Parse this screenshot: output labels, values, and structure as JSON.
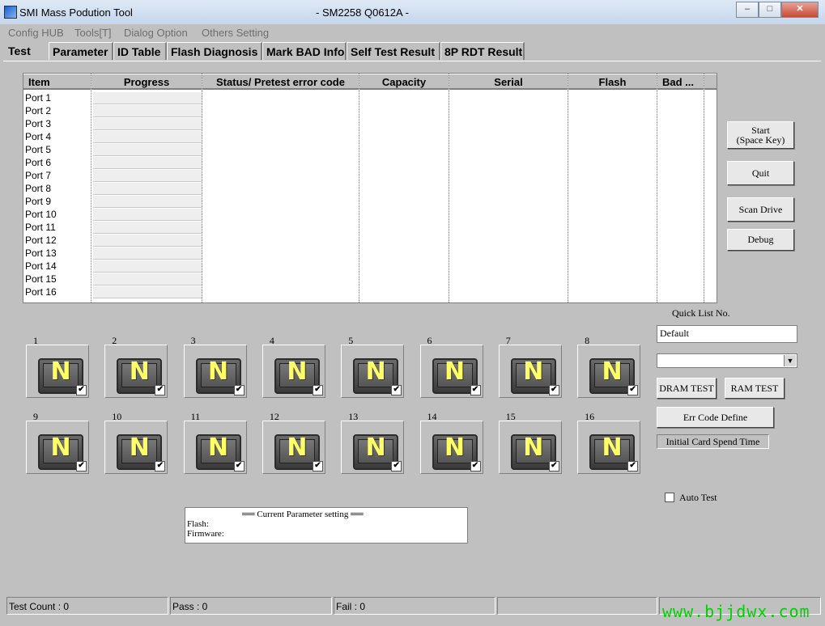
{
  "window": {
    "app_title": "SMI Mass Podution Tool",
    "center_title": "- SM2258 Q0612A -",
    "controls": {
      "minimize": "–",
      "maximize": "□",
      "close": "✕"
    }
  },
  "menu": [
    "Config HUB",
    "Tools[T]",
    "Dialog Option",
    "Others Setting"
  ],
  "tabs": [
    "Test",
    "Parameter",
    "ID Table",
    "Flash Diagnosis",
    "Mark BAD Info",
    "Self Test Result",
    "8P RDT Result"
  ],
  "active_tab": "Test",
  "table": {
    "columns": [
      "Item",
      "Progress",
      "Status/ Pretest error code",
      "Capacity",
      "Serial",
      "Flash",
      "Bad ..."
    ],
    "rows": [
      "Port 1",
      "Port 2",
      "Port 3",
      "Port 4",
      "Port 5",
      "Port 6",
      "Port 7",
      "Port 8",
      "Port 9",
      "Port 10",
      "Port 11",
      "Port 12",
      "Port 13",
      "Port 14",
      "Port 15",
      "Port 16"
    ]
  },
  "buttons": {
    "start_line1": "Start",
    "start_line2": "(Space Key)",
    "quit": "Quit",
    "scan_drive": "Scan Drive",
    "debug": "Debug",
    "dram_test": "DRAM TEST",
    "ram_test": "RAM TEST",
    "err_code_define": "Err Code Define",
    "initial_card_spend_time": "Initial Card Spend Time"
  },
  "quick_list": {
    "label": "Quick List No.",
    "value": "Default",
    "dropdown_value": ""
  },
  "auto_test": {
    "label": "Auto Test",
    "checked": false
  },
  "ports": [
    {
      "num": "1",
      "letter": "N",
      "checked": true
    },
    {
      "num": "2",
      "letter": "N",
      "checked": true
    },
    {
      "num": "3",
      "letter": "N",
      "checked": true
    },
    {
      "num": "4",
      "letter": "N",
      "checked": true
    },
    {
      "num": "5",
      "letter": "N",
      "checked": true
    },
    {
      "num": "6",
      "letter": "N",
      "checked": true
    },
    {
      "num": "7",
      "letter": "N",
      "checked": true
    },
    {
      "num": "8",
      "letter": "N",
      "checked": true
    },
    {
      "num": "9",
      "letter": "N",
      "checked": true
    },
    {
      "num": "10",
      "letter": "N",
      "checked": true
    },
    {
      "num": "11",
      "letter": "N",
      "checked": true
    },
    {
      "num": "12",
      "letter": "N",
      "checked": true
    },
    {
      "num": "13",
      "letter": "N",
      "checked": true
    },
    {
      "num": "14",
      "letter": "N",
      "checked": true
    },
    {
      "num": "15",
      "letter": "N",
      "checked": true
    },
    {
      "num": "16",
      "letter": "N",
      "checked": true
    }
  ],
  "current_param": {
    "header": "══ Current Parameter setting ══",
    "flash_label": "Flash:",
    "firmware_label": "Firmware:"
  },
  "status": {
    "test_count": "Test Count : 0",
    "pass": "Pass : 0",
    "fail": "Fail : 0",
    "extra": ""
  },
  "watermark": "www.bjjdwx.com",
  "colors": {
    "face": "#c0c0c0",
    "card_letter": "#ffff66",
    "watermark": "#00d000"
  }
}
